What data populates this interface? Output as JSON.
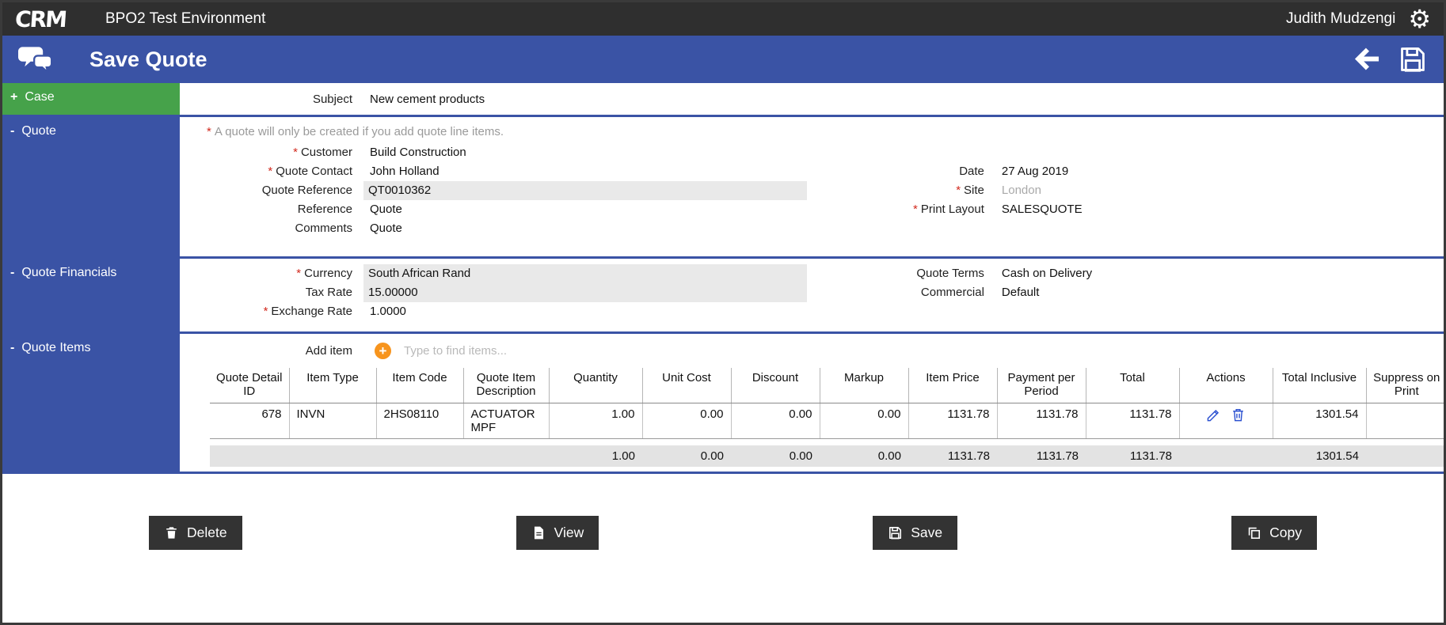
{
  "required_marker": "*",
  "icons": {
    "logo": "CRM",
    "gear": "⚙",
    "add_plus": "+"
  },
  "colors": {
    "top_bar": "#2F2F2F",
    "accent_blue": "#3A53A5",
    "case_green": "#46A24A",
    "required_red": "#D22A1E",
    "add_button_orange": "#F7941D",
    "action_icon_blue": "#2B50D0",
    "readonly_field_gray": "#E9E9E9",
    "totals_row_gray": "#E3E3E3",
    "footer_button_dark": "#333333"
  },
  "top_bar": {
    "title": "BPO2 Test Environment",
    "user": "Judith Mudzengi"
  },
  "header": {
    "title": "Save Quote"
  },
  "sidebar": {
    "items": [
      {
        "toggle": "+",
        "label": "Case"
      },
      {
        "toggle": "-",
        "label": "Quote"
      },
      {
        "toggle": "-",
        "label": "Quote Financials"
      },
      {
        "toggle": "-",
        "label": "Quote Items"
      }
    ]
  },
  "case": {
    "subject_label": "Subject",
    "subject_value": "New cement products"
  },
  "quote": {
    "note": "A quote will only be created if you add quote line items.",
    "customer_label": "Customer",
    "customer_value": "Build Construction",
    "contact_label": "Quote Contact",
    "contact_value": "John Holland",
    "reference_label": "Quote Reference",
    "reference_value": "QT0010362",
    "reference2_label": "Reference",
    "reference2_value": "Quote",
    "comments_label": "Comments",
    "comments_value": "Quote",
    "date_label": "Date",
    "date_value": "27 Aug 2019",
    "site_label": "Site",
    "site_value": "London",
    "print_layout_label": "Print Layout",
    "print_layout_value": "SALESQUOTE"
  },
  "financials": {
    "currency_label": "Currency",
    "currency_value": "South African Rand",
    "tax_rate_label": "Tax Rate",
    "tax_rate_value": "15.00000",
    "exchange_rate_label": "Exchange Rate",
    "exchange_rate_value": "1.0000",
    "terms_label": "Quote Terms",
    "terms_value": "Cash on Delivery",
    "commercial_label": "Commercial",
    "commercial_value": "Default"
  },
  "items": {
    "add_item_label": "Add item",
    "find_placeholder": "Type to find items...",
    "columns": [
      "Quote Detail ID",
      "Item Type",
      "Item Code",
      "Quote Item Description",
      "Quantity",
      "Unit Cost",
      "Discount",
      "Markup",
      "Item Price",
      "Payment per Period",
      "Total",
      "Actions",
      "Total Inclusive",
      "Suppress on Print"
    ],
    "row": {
      "quote_detail_id": "678",
      "item_type": "INVN",
      "item_code": "2HS08110",
      "description": "ACTUATOR MPF",
      "quantity": "1.00",
      "unit_cost": "0.00",
      "discount": "0.00",
      "markup": "0.00",
      "item_price": "1131.78",
      "payment_per_period": "1131.78",
      "total": "1131.78",
      "total_inclusive": "1301.54",
      "suppress_on_print": ""
    },
    "totals": {
      "quantity": "1.00",
      "unit_cost": "0.00",
      "discount": "0.00",
      "markup": "0.00",
      "item_price": "1131.78",
      "payment_per_period": "1131.78",
      "total": "1131.78",
      "total_inclusive": "1301.54"
    }
  },
  "footer": {
    "buttons": [
      {
        "label": "Delete"
      },
      {
        "label": "View"
      },
      {
        "label": "Save"
      },
      {
        "label": "Copy"
      }
    ]
  }
}
